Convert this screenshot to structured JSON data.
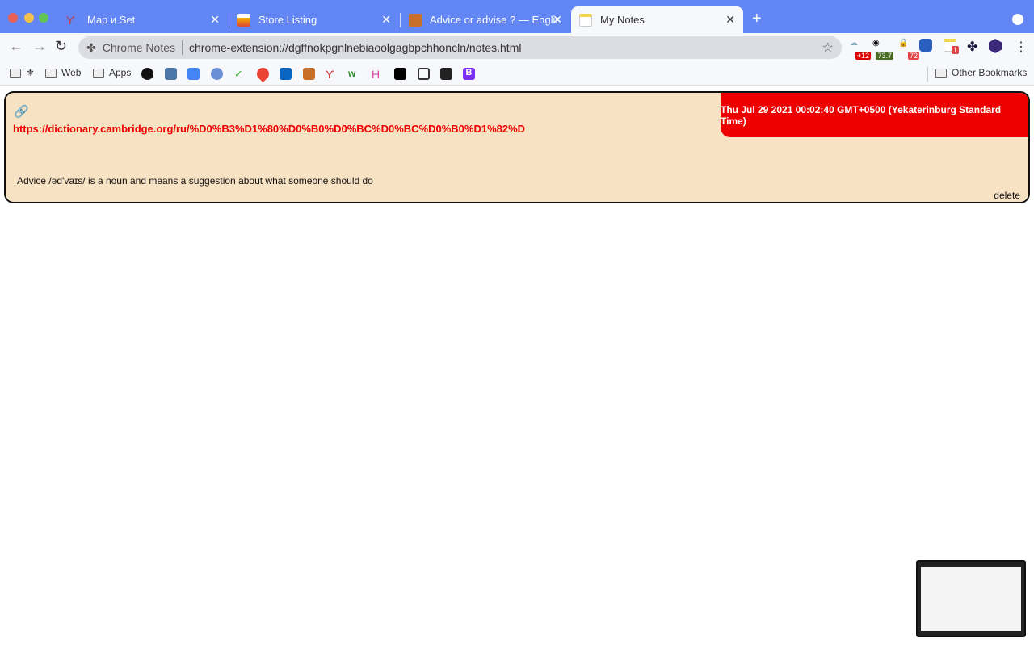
{
  "tabs": [
    {
      "title": "Map и Set",
      "active": false
    },
    {
      "title": "Store Listing",
      "active": false
    },
    {
      "title": "Advice or advise ? — English G",
      "active": false
    },
    {
      "title": "My Notes",
      "active": true
    }
  ],
  "omnibox": {
    "extension_name": "Chrome Notes",
    "url": "chrome-extension://dgffnokpgnlnebiaoolgagbpchhoncln/notes.html"
  },
  "extension_badges": {
    "weather": "+12",
    "currency": "73.7",
    "password": "72",
    "notes": "1"
  },
  "bookmarks": {
    "items": [
      "Web",
      "Apps"
    ],
    "other": "Other Bookmarks"
  },
  "note": {
    "date": "Thu Jul 29 2021 00:02:40 GMT+0500 (Yekaterinburg Standard Time)",
    "url": "https://dictionary.cambridge.org/ru/%D0%B3%D1%80%D0%B0%D0%BC%D0%BC%D0%B0%D1%82%D",
    "text": "Advice /əd'vaɪs/ is a noun and means a suggestion about what someone should do",
    "delete_label": "delete"
  },
  "colors": {
    "tabbar": "#6287f5",
    "note_bg": "#f8e2c4",
    "accent_red": "#e00000"
  }
}
